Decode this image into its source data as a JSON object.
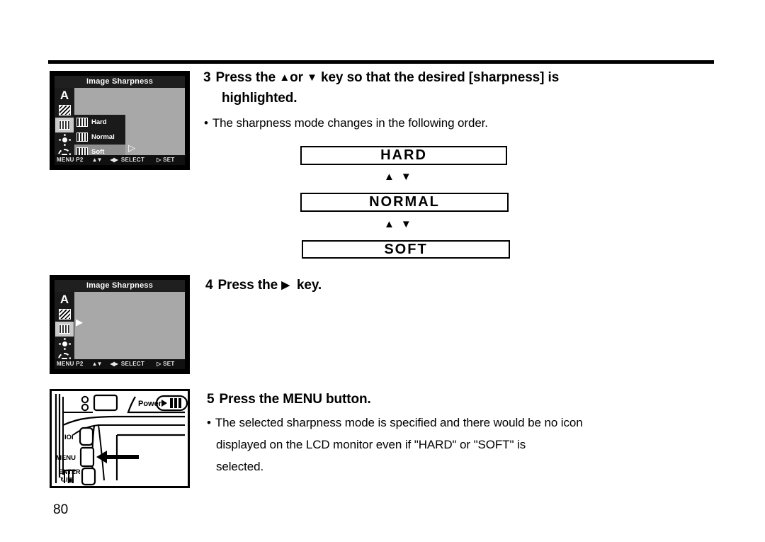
{
  "page": {
    "number": "80"
  },
  "lcd_screen_1": {
    "title": "Image Sharpness",
    "sidebar_icons": [
      {
        "name": "auto-white-balance-icon",
        "glyph": "A"
      },
      {
        "name": "image-quality-icon",
        "glyph": "hatch"
      },
      {
        "name": "image-sharpness-icon",
        "glyph": "bars"
      },
      {
        "name": "brightness-icon",
        "glyph": "sun"
      },
      {
        "name": "camera-setup-icon",
        "glyph": "camera"
      }
    ],
    "submenu": [
      {
        "label": "Hard",
        "selected": false
      },
      {
        "label": "Normal",
        "selected": false
      },
      {
        "label": "Soft",
        "selected": true
      }
    ],
    "selection_arrow": "▷",
    "status_bar": {
      "menu": "MENU P2",
      "updown": "▲▼",
      "leftright": "◀▶",
      "select": "SELECT",
      "set": "▷ SET"
    }
  },
  "lcd_screen_2": {
    "title": "Image Sharpness",
    "sidebar_icons": [
      {
        "name": "auto-white-balance-icon",
        "glyph": "A"
      },
      {
        "name": "image-quality-icon",
        "glyph": "hatch"
      },
      {
        "name": "image-sharpness-icon",
        "glyph": "bars"
      },
      {
        "name": "brightness-icon",
        "glyph": "sun"
      },
      {
        "name": "camera-setup-icon",
        "glyph": "camera"
      }
    ],
    "selection_arrow": "▶",
    "status_bar": {
      "menu": "MENU P2",
      "updown": "▲▼",
      "leftright": "◀▶",
      "select": "SELECT",
      "set": "▷ SET"
    }
  },
  "steps": {
    "step3": {
      "number": "3",
      "text_before": "Press the",
      "up_arrow": "▲",
      "text_or": "or",
      "down_arrow": "▼",
      "text_after": "key so that the desired [sharpness] is",
      "line2": "highlighted.",
      "bullet": "The sharpness mode changes in the following order.",
      "bullet_marker": "•"
    },
    "step4": {
      "number": "4",
      "text_before": "Press the",
      "right_arrow": "▶",
      "text_after": "key."
    },
    "step5": {
      "number": "5",
      "text": "Press the MENU button.",
      "bullet_marker": "•",
      "bullet_line1": "The selected sharpness mode is specified and there would be no icon",
      "bullet_line2": "displayed on the LCD monitor even if  \"HARD\" or \"SOFT\" is",
      "bullet_line3": "selected."
    }
  },
  "flow_diagram": {
    "boxes": [
      {
        "label": "HARD"
      },
      {
        "label": "NORMAL"
      },
      {
        "label": "SOFT"
      }
    ],
    "connector": "▲▼"
  },
  "camera_illustration": {
    "power_label": "Power",
    "power_playback_icon": "▷",
    "display_button_label": "IOI",
    "menu_button_label": "MENU",
    "enter_button_label": "ENTER",
    "enter_button_sublabel": "↻/❐"
  }
}
